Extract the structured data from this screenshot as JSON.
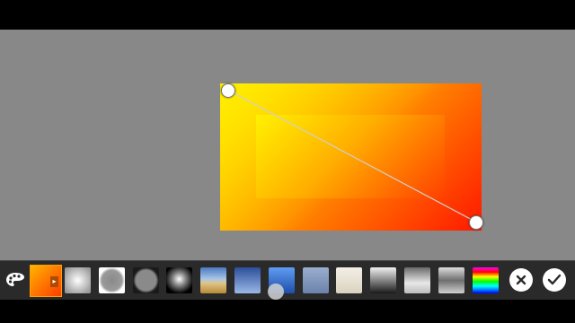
{
  "editor": {
    "gradient": {
      "outer_colors": [
        "#ffd200",
        "#ff8a00",
        "#ff1800"
      ],
      "inner_colors": [
        "#fff200",
        "#ffb000",
        "#ff4000"
      ]
    }
  },
  "toolbar": {
    "palette_icon": "palette-icon",
    "presets": [
      {
        "name": "preset-orange-red",
        "style": "linear-gradient(135deg,#ffb400,#ff3c00)"
      },
      {
        "name": "preset-radial-light",
        "style": "radial-gradient(circle,#ffffff 0%,#9a9a9a 85%)"
      },
      {
        "name": "preset-radial-white-ring",
        "style": "radial-gradient(circle,#8a8a8a 0%,#9a9a9a 55%,#ffffff 70%,#ffffff 100%)"
      },
      {
        "name": "preset-radial-dark-ring",
        "style": "radial-gradient(circle,#8a8a8a 0%,#8a8a8a 55%,#1a1a1a 70%,#1a1a1a 100%)"
      },
      {
        "name": "preset-sphere",
        "style": "radial-gradient(circle at 50% 45%,#ffffff 0%,#808080 35%,#000000 75%)"
      },
      {
        "name": "preset-sky-sand",
        "style": "linear-gradient(180deg,#4b78c0 0%,#a8c6e8 45%,#e0c58a 60%,#b88a36 100%)"
      },
      {
        "name": "preset-blue-fade",
        "style": "linear-gradient(180deg,#2c4f9a 0%,#9ab8e6 100%)"
      },
      {
        "name": "preset-blue-bright",
        "style": "linear-gradient(180deg,#5f9cf2 0%,#1f4ea8 100%)"
      },
      {
        "name": "preset-steel-blue",
        "style": "linear-gradient(180deg,#9aaecf 0%,#6c82aa 100%)"
      },
      {
        "name": "preset-cream",
        "style": "linear-gradient(180deg,#f4f0e6 0%,#d9d2c0 100%)"
      },
      {
        "name": "preset-metal-dark",
        "style": "linear-gradient(180deg,#f0f0f0 0%,#9a9a9a 40%,#1a1a1a 100%)"
      },
      {
        "name": "preset-metal-light",
        "style": "linear-gradient(180deg,#6a6a6a 0%,#e8e8e8 60%,#bcbcbc 100%)"
      },
      {
        "name": "preset-chrome",
        "style": "linear-gradient(180deg,#dcdcdc 0%,#6e6e6e 50%,#d0d0d0 100%)"
      },
      {
        "name": "preset-rainbow",
        "style": "linear-gradient(180deg,#ff00ff 0%,#ff0000 18%,#ffff00 36%,#00ff00 54%,#00ffff 72%,#0000ff 100%)"
      }
    ],
    "cancel_icon": "close-icon",
    "confirm_icon": "checkmark-icon"
  }
}
